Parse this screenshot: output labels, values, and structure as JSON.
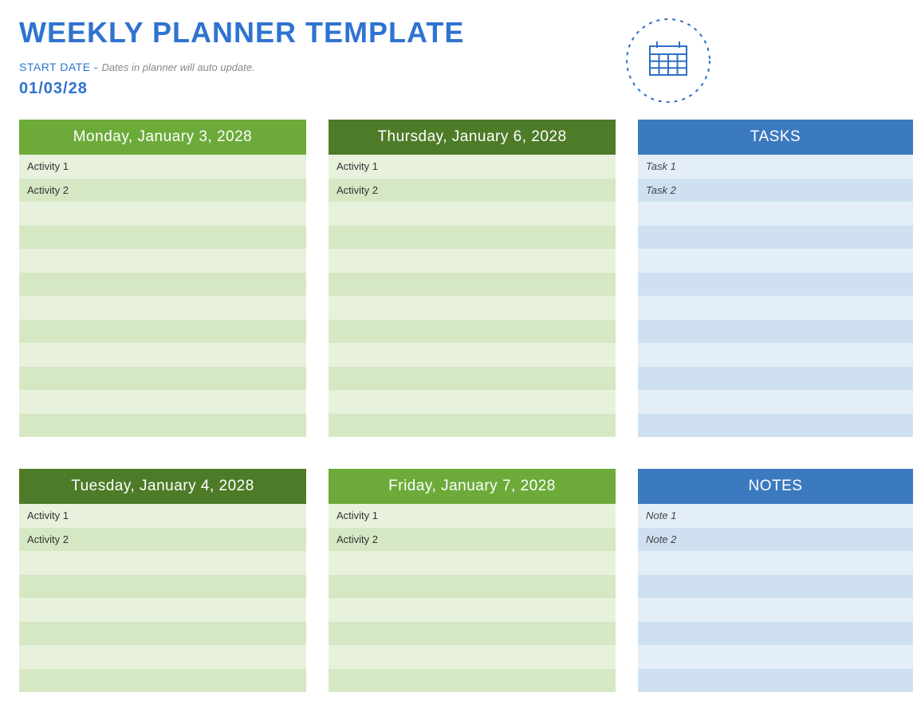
{
  "title": "WEEKLY PLANNER TEMPLATE",
  "startLabel": "START DATE - ",
  "startHint": "Dates in planner will auto update.",
  "startDate": "01/03/28",
  "cards": {
    "monday": {
      "header": "Monday, January 3, 2028",
      "rows": [
        "Activity 1",
        "Activity 2",
        "",
        "",
        "",
        "",
        "",
        "",
        "",
        "",
        "",
        ""
      ]
    },
    "thursday": {
      "header": "Thursday, January 6, 2028",
      "rows": [
        "Activity 1",
        "Activity 2",
        "",
        "",
        "",
        "",
        "",
        "",
        "",
        "",
        "",
        ""
      ]
    },
    "tasks": {
      "header": "TASKS",
      "rows": [
        "Task 1",
        "Task 2",
        "",
        "",
        "",
        "",
        "",
        "",
        "",
        "",
        "",
        ""
      ]
    },
    "tuesday": {
      "header": "Tuesday, January 4, 2028",
      "rows": [
        "Activity 1",
        "Activity 2",
        "",
        "",
        "",
        "",
        "",
        ""
      ]
    },
    "friday": {
      "header": "Friday, January 7, 2028",
      "rows": [
        "Activity 1",
        "Activity 2",
        "",
        "",
        "",
        "",
        "",
        ""
      ]
    },
    "notes": {
      "header": "NOTES",
      "rows": [
        "Note 1",
        "Note 2",
        "",
        "",
        "",
        "",
        "",
        ""
      ]
    }
  }
}
